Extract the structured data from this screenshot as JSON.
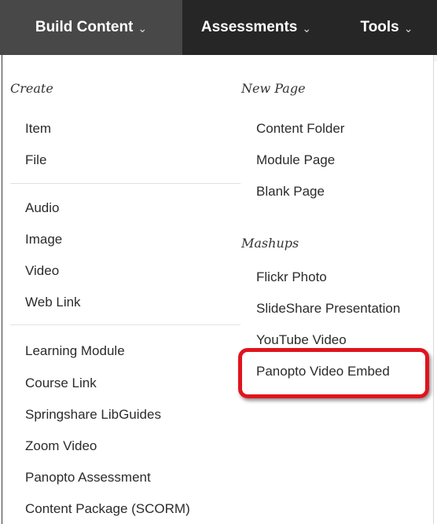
{
  "toolbar": {
    "tabs": [
      {
        "label": "Build Content",
        "icon": "chevron-down-icon"
      },
      {
        "label": "Assessments",
        "icon": "chevron-down-icon"
      },
      {
        "label": "Tools",
        "icon": "chevron-down-icon"
      }
    ],
    "caret": "⌄"
  },
  "menu": {
    "left": {
      "create_heading": "Create",
      "group1": [
        "Item",
        "File"
      ],
      "group2": [
        "Audio",
        "Image",
        "Video",
        "Web Link"
      ],
      "group3": [
        "Learning Module",
        "Course Link",
        "Springshare LibGuides",
        "Zoom Video",
        "Panopto Assessment",
        "Content Package (SCORM)"
      ]
    },
    "right": {
      "new_page_heading": "New Page",
      "new_page_items": [
        "Content Folder",
        "Module Page",
        "Blank Page"
      ],
      "mashups_heading": "Mashups",
      "mashups_items": [
        "Flickr Photo",
        "SlideShare Presentation",
        "YouTube Video",
        "Panopto Video Embed"
      ]
    }
  },
  "colors": {
    "highlight_border": "#e0141d",
    "active_tab": "#484848",
    "inactive_tab": "#262626"
  }
}
